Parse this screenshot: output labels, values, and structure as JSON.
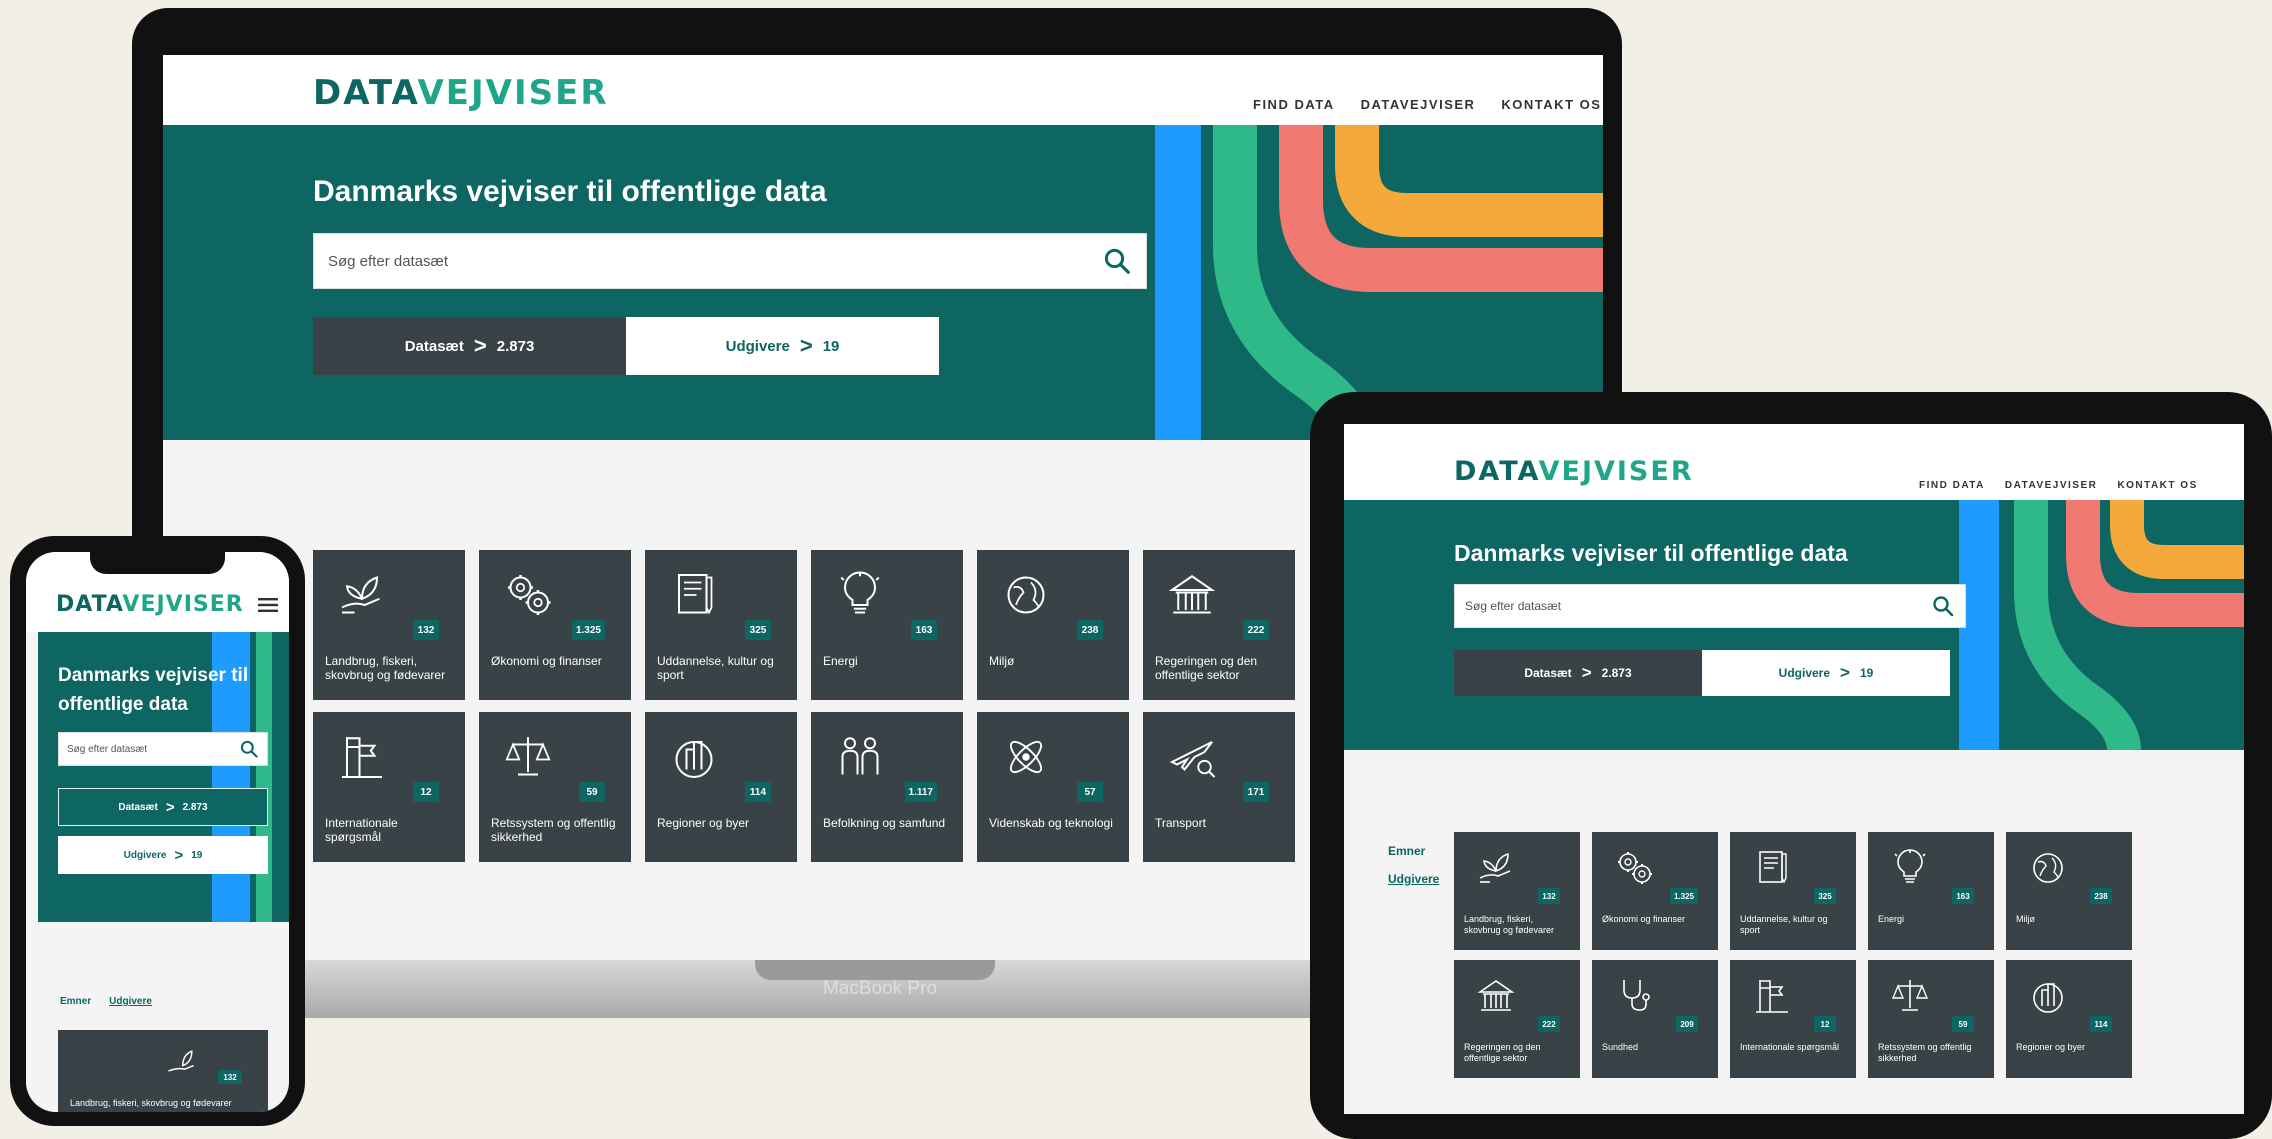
{
  "brand": {
    "logo_dark": "DATA",
    "logo_light": "VEJVISER"
  },
  "nav": {
    "find_data": "FIND DATA",
    "datavejviser": "DATAVEJVISER",
    "kontakt": "KONTAKT OS"
  },
  "hero": {
    "title": "Danmarks vejviser til offentlige data"
  },
  "search": {
    "placeholder": "Søg efter datasæt"
  },
  "counts": {
    "datasets_label": "Datasæt",
    "datasets_value": "2.873",
    "publishers_label": "Udgivere",
    "publishers_value": "19",
    "chevron": ">"
  },
  "tabs": {
    "emner": "Emner",
    "udgivere": "Udgivere"
  },
  "device": {
    "laptop_caption": "MacBook Pro"
  },
  "laptop_tiles": [
    {
      "label": "Landbrug, fiskeri, skovbrug og fødevarer",
      "count": "132",
      "icon": "plant-hand-icon"
    },
    {
      "label": "Økonomi og finanser",
      "count": "1.325",
      "icon": "gears-euro-icon"
    },
    {
      "label": "Uddannelse, kultur og sport",
      "count": "325",
      "icon": "book-icon"
    },
    {
      "label": "Energi",
      "count": "163",
      "icon": "bulb-icon"
    },
    {
      "label": "Miljø",
      "count": "238",
      "icon": "globe-icon"
    },
    {
      "label": "Regeringen og den offentlige sektor",
      "count": "222",
      "icon": "building-icon"
    },
    {
      "label": "Internationale spørgsmål",
      "count": "12",
      "icon": "flags-icon"
    },
    {
      "label": "Retssystem og offentlig sikkerhed",
      "count": "59",
      "icon": "scales-icon"
    },
    {
      "label": "Regioner og byer",
      "count": "114",
      "icon": "city-globe-icon"
    },
    {
      "label": "Befolkning og samfund",
      "count": "1.117",
      "icon": "people-icon"
    },
    {
      "label": "Videnskab og teknologi",
      "count": "57",
      "icon": "atom-icon"
    },
    {
      "label": "Transport",
      "count": "171",
      "icon": "plane-icon"
    }
  ],
  "tablet_tiles": [
    {
      "label": "Landbrug, fiskeri, skovbrug og fødevarer",
      "count": "132",
      "icon": "plant-hand-icon"
    },
    {
      "label": "Økonomi og finanser",
      "count": "1.325",
      "icon": "gears-euro-icon"
    },
    {
      "label": "Uddannelse, kultur og sport",
      "count": "325",
      "icon": "book-icon"
    },
    {
      "label": "Energi",
      "count": "163",
      "icon": "bulb-icon"
    },
    {
      "label": "Miljø",
      "count": "238",
      "icon": "globe-icon"
    },
    {
      "label": "Regeringen og den offentlige sektor",
      "count": "222",
      "icon": "building-icon"
    },
    {
      "label": "Sundhed",
      "count": "209",
      "icon": "stethoscope-icon"
    },
    {
      "label": "Internationale spørgsmål",
      "count": "12",
      "icon": "flags-icon"
    },
    {
      "label": "Retssystem og offentlig sikkerhed",
      "count": "59",
      "icon": "scales-icon"
    },
    {
      "label": "Regioner og byer",
      "count": "114",
      "icon": "city-globe-icon"
    }
  ],
  "phone_tile": {
    "label": "Landbrug, fiskeri, skovbrug og fødevarer",
    "count": "132",
    "icon": "plant-hand-icon"
  },
  "colors": {
    "teal": "#0d6662",
    "tile": "#394246",
    "blue": "#1e9bff",
    "green": "#2fb888",
    "salmon": "#f07a72",
    "orange": "#f6a93b"
  }
}
